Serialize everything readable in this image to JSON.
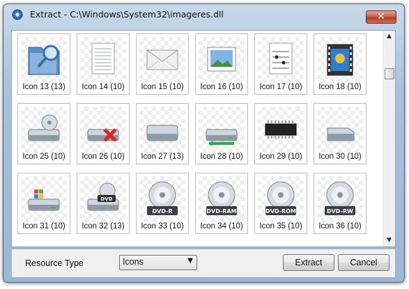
{
  "window": {
    "title": "Extract - C:\\Windows\\System32\\imageres.dll",
    "close_glyph": "✕",
    "app_icon": "extract-tool-icon"
  },
  "icons": [
    {
      "label": "Icon 13 (13)",
      "icon": "folder-magnifier-icon"
    },
    {
      "label": "Icon 14 (10)",
      "icon": "text-document-icon"
    },
    {
      "label": "Icon 15 (10)",
      "icon": "envelope-icon"
    },
    {
      "label": "Icon 16 (10)",
      "icon": "picture-icon"
    },
    {
      "label": "Icon 17 (10)",
      "icon": "music-sheet-icon"
    },
    {
      "label": "Icon 18 (10)",
      "icon": "video-film-icon"
    },
    {
      "label": "Icon 25 (10)",
      "icon": "cd-drive-icon"
    },
    {
      "label": "Icon 26 (10)",
      "icon": "network-drive-disconnected-icon"
    },
    {
      "label": "Icon 27 (13)",
      "icon": "hard-drive-icon"
    },
    {
      "label": "Icon 28 (10)",
      "icon": "network-drive-icon"
    },
    {
      "label": "Icon 29 (10)",
      "icon": "memory-chip-icon"
    },
    {
      "label": "Icon 30 (10)",
      "icon": "removable-drive-icon"
    },
    {
      "label": "Icon 31 (10)",
      "icon": "windows-drive-icon"
    },
    {
      "label": "Icon 32 (13)",
      "icon": "dvd-drive-icon"
    },
    {
      "label": "Icon 33 (10)",
      "icon": "dvd-r-disc-icon",
      "disc_text": "DVD-R"
    },
    {
      "label": "Icon 34 (10)",
      "icon": "dvd-ram-disc-icon",
      "disc_text": "DVD-RAM"
    },
    {
      "label": "Icon 35 (10)",
      "icon": "dvd-rom-disc-icon",
      "disc_text": "DVD-ROM"
    },
    {
      "label": "Icon 36 (10)",
      "icon": "dvd-rw-disc-icon",
      "disc_text": "DVD-RW"
    }
  ],
  "drive_badge_text": "DVD",
  "scrollbar": {
    "up_glyph": "▲",
    "down_glyph": "▼"
  },
  "footer": {
    "resource_type_label": "Resource Type",
    "resource_type_value": "Icons",
    "dropdown_glyph": "▼",
    "extract_label": "Extract",
    "cancel_label": "Cancel"
  }
}
